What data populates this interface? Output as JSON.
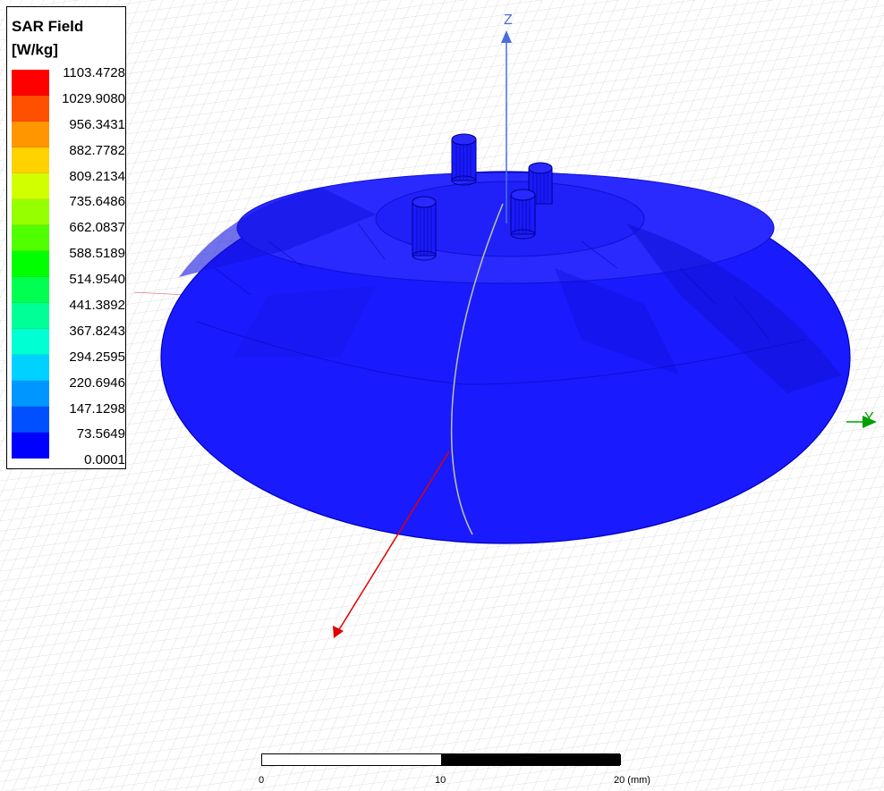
{
  "legend": {
    "title_line1": "SAR Field",
    "title_line2": "[W/kg]",
    "values": [
      "1103.4728",
      "1029.9080",
      "956.3431",
      "882.7782",
      "809.2134",
      "735.6486",
      "662.0837",
      "588.5189",
      "514.9540",
      "441.3892",
      "367.8243",
      "294.2595",
      "220.6946",
      "147.1298",
      "73.5649",
      "0.0001"
    ],
    "colors": [
      "#ff0000",
      "#ff5000",
      "#ff9600",
      "#ffd200",
      "#d2ff00",
      "#96ff00",
      "#50ff00",
      "#00ff00",
      "#00ff50",
      "#00ff96",
      "#00ffd2",
      "#00d2ff",
      "#0096ff",
      "#0050ff",
      "#0000ff"
    ]
  },
  "axes": {
    "z_label": "Z",
    "y_label": "Y",
    "z_color": "#4a6ee0",
    "y_color": "#00a000",
    "x_color": "#e00000"
  },
  "model": {
    "surface_color": "#1a1aff"
  },
  "scale_bar": {
    "tick_0": "0",
    "tick_10": "10",
    "tick_20": "20 (mm)"
  }
}
